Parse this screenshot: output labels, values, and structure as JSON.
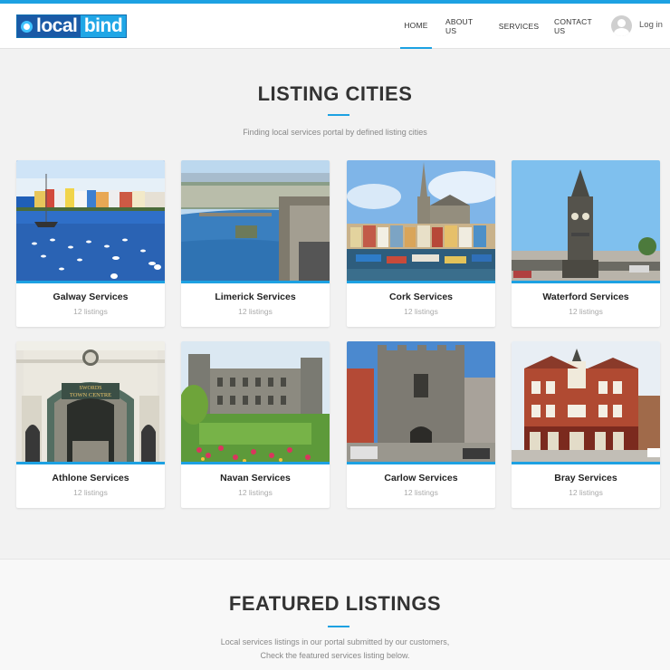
{
  "brand": {
    "logo_left": "local",
    "logo_right": "bind"
  },
  "nav": {
    "items": [
      {
        "label": "HOME",
        "active": true
      },
      {
        "label": "ABOUT US",
        "active": false
      },
      {
        "label": "SERVICES",
        "active": false
      },
      {
        "label": "CONTACT US",
        "active": false
      }
    ],
    "login_label": "Log in"
  },
  "listing": {
    "title_light": "LISTING ",
    "title_bold": "CITIES",
    "subtitle": "Finding local services portal by defined listing cities",
    "cities": [
      {
        "name": "Galway Services",
        "count": "12 listings"
      },
      {
        "name": "Limerick Services",
        "count": "12 listings"
      },
      {
        "name": "Cork Services",
        "count": "12 listings"
      },
      {
        "name": "Waterford Services",
        "count": "12 listings"
      },
      {
        "name": "Athlone Services",
        "count": "12 listings"
      },
      {
        "name": "Navan Services",
        "count": "12 listings"
      },
      {
        "name": "Carlow Services",
        "count": "12 listings"
      },
      {
        "name": "Bray Services",
        "count": "12 listings"
      }
    ]
  },
  "featured": {
    "title_bold": "FEATURED",
    "title_light": " LISTINGS",
    "subtitle_line1": "Local services listings in our portal submitted by our customers,",
    "subtitle_line2": "Check the featured services listing below."
  },
  "signage": {
    "athlone_sign_1": "SWORDS",
    "athlone_sign_2": "TOWN CENTRE"
  },
  "colors": {
    "accent": "#1da1e2",
    "logo_dark": "#1a5aa6",
    "logo_light": "#20a6e6"
  }
}
